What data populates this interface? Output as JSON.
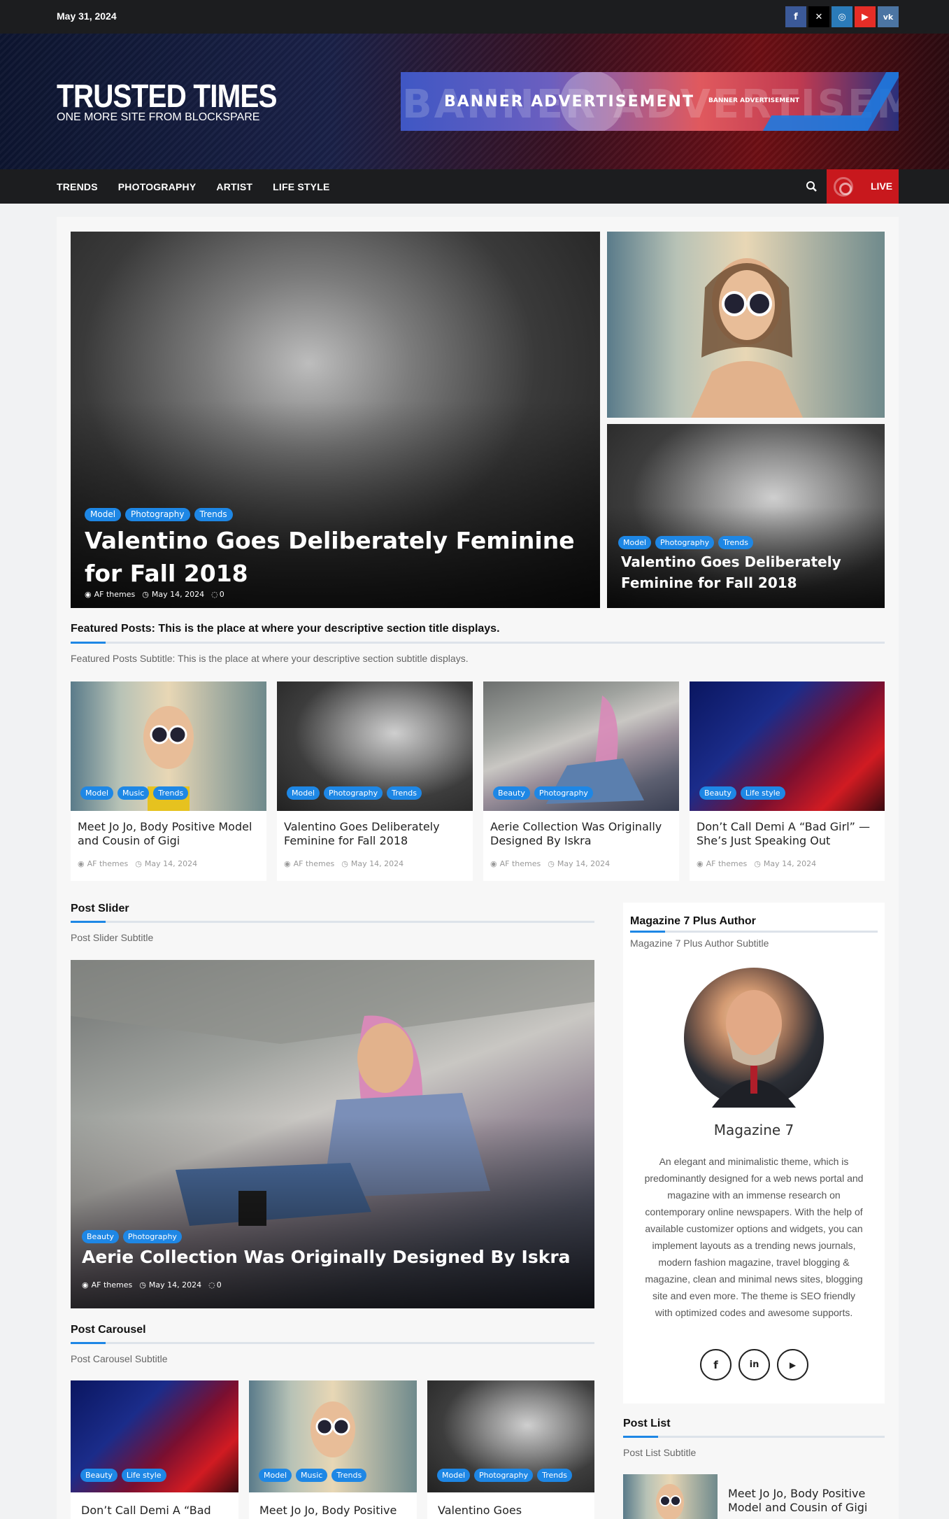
{
  "topbar": {
    "date": "May 31, 2024",
    "social_icons": [
      "facebook-icon",
      "x-icon",
      "instagram-icon",
      "youtube-icon",
      "vk-icon"
    ]
  },
  "masthead": {
    "site_title": "TRUSTED TIMES",
    "tagline": "ONE MORE SITE FROM BLOCKSPARE",
    "banner_text": "BANNER ADVERTISEMENT",
    "banner_ghost_text": "BANNER ADVERTISEMENT",
    "banner_small_text": "BANNER ADVERTISEMENT"
  },
  "nav": {
    "items": [
      "TRENDS",
      "PHOTOGRAPHY",
      "ARTIST",
      "LIFE STYLE"
    ],
    "live_label": "LIVE"
  },
  "hero": {
    "main": {
      "tags": [
        "Model",
        "Photography",
        "Trends"
      ],
      "title": "Valentino Goes Deliberately Feminine for Fall 2018",
      "author": "AF themes",
      "date": "May 14, 2024",
      "comments": "0"
    },
    "side_bottom": {
      "tags": [
        "Model",
        "Photography",
        "Trends"
      ],
      "title": "Valentino Goes Deliberately Feminine for Fall 2018"
    }
  },
  "featured": {
    "title": "Featured Posts: This is the place at where your descriptive section title displays.",
    "subtitle": "Featured Posts Subtitle: This is the place at where your descriptive section subtitle displays.",
    "cards": [
      {
        "tags": [
          "Model",
          "Music",
          "Trends"
        ],
        "title": "Meet Jo Jo, Body Positive Model and Cousin of Gigi",
        "author": "AF themes",
        "date": "May 14, 2024"
      },
      {
        "tags": [
          "Model",
          "Photography",
          "Trends"
        ],
        "title": "Valentino Goes Deliberately Feminine for Fall 2018",
        "author": "AF themes",
        "date": "May 14, 2024"
      },
      {
        "tags": [
          "Beauty",
          "Photography"
        ],
        "title": "Aerie Collection Was Originally Designed By Iskra",
        "author": "AF themes",
        "date": "May 14, 2024"
      },
      {
        "tags": [
          "Beauty",
          "Life style"
        ],
        "title": "Don’t Call Demi A “Bad Girl” — She’s Just Speaking Out",
        "author": "AF themes",
        "date": "May 14, 2024"
      }
    ]
  },
  "post_slider": {
    "title": "Post Slider",
    "subtitle": "Post Slider Subtitle",
    "slide": {
      "tags": [
        "Beauty",
        "Photography"
      ],
      "title": "Aerie Collection Was Originally Designed By Iskra",
      "author": "AF themes",
      "date": "May 14, 2024",
      "comments": "0"
    }
  },
  "author_widget": {
    "title": "Magazine 7 Plus Author",
    "subtitle": "Magazine 7 Plus Author Subtitle",
    "name": "Magazine 7",
    "description": "An elegant and minimalistic theme, which is predominantly designed for a web news portal and magazine with an immense research on contemporary online newspapers. With the help of available customizer options and widgets, you can implement layouts as a trending news journals, modern fashion magazine, travel blogging & magazine, clean and minimal news sites, blogging site and even more. The theme is SEO friendly with optimized codes and awesome supports.",
    "social": [
      "f",
      "in",
      "▶"
    ]
  },
  "post_carousel": {
    "title": "Post Carousel",
    "subtitle": "Post Carousel Subtitle",
    "items": [
      {
        "tags": [
          "Beauty",
          "Life style"
        ],
        "title": "Don’t Call Demi A “Bad"
      },
      {
        "tags": [
          "Model",
          "Music",
          "Trends"
        ],
        "title": "Meet Jo Jo, Body Positive"
      },
      {
        "tags": [
          "Model",
          "Photography",
          "Trends"
        ],
        "title": "Valentino Goes"
      }
    ]
  },
  "post_list": {
    "title": "Post List",
    "subtitle": "Post List Subtitle",
    "items": [
      {
        "title": "Meet Jo Jo, Body Positive Model and Cousin of Gigi"
      }
    ]
  },
  "colors": {
    "accent": "#1e87e5",
    "live": "#c8181d",
    "dark": "#1c1d1f"
  }
}
